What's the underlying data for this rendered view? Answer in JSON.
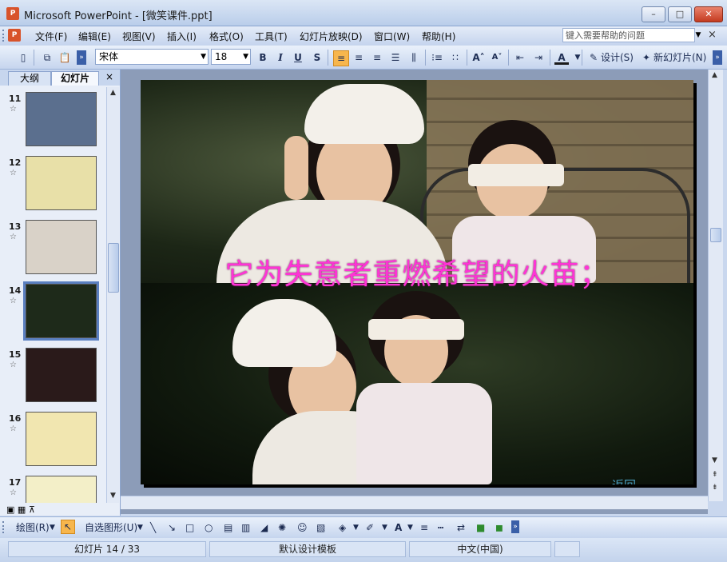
{
  "window": {
    "title": "Microsoft PowerPoint - [微笑课件.ppt]",
    "app_icon": "powerpoint-icon"
  },
  "menu": {
    "items": [
      "文件(F)",
      "编辑(E)",
      "视图(V)",
      "插入(I)",
      "格式(O)",
      "工具(T)",
      "幻灯片放映(D)",
      "窗口(W)",
      "帮助(H)"
    ],
    "help_placeholder": "键入需要帮助的问题",
    "close_glyph": "×"
  },
  "toolbar": {
    "font_name": "宋体",
    "font_size": "18",
    "bold": "B",
    "italic": "I",
    "underline": "U",
    "shadow": "S",
    "font_color_label": "A",
    "design_label": "设计(S)",
    "new_slide_label": "新幻灯片(N)"
  },
  "left_pane": {
    "tab_outline": "大纲",
    "tab_slides": "幻灯片",
    "close_glyph": "×",
    "slides": [
      {
        "number": "11",
        "bg": "#5b6f8e"
      },
      {
        "number": "12",
        "bg": "#e8e0a8"
      },
      {
        "number": "13",
        "bg": "#d9d2c8"
      },
      {
        "number": "14",
        "bg": "#1e2a1a",
        "selected": true
      },
      {
        "number": "15",
        "bg": "#2a1a1a"
      },
      {
        "number": "16",
        "bg": "#f1e6b0"
      },
      {
        "number": "17",
        "bg": "#f3efc8"
      }
    ]
  },
  "slide": {
    "caption": "它为失意者重燃希望的火苗；",
    "return_link": "返回"
  },
  "draw_toolbar": {
    "draw_label": "绘图(R)",
    "autoshapes_label": "自选图形(U)"
  },
  "status": {
    "slide_position": "幻灯片 14 / 33",
    "template": "默认设计模板",
    "language": "中文(中国)"
  },
  "colors": {
    "caption": "#ff33d6",
    "return_link": "#4aa0c2",
    "accent_highlight": "#f7b64d"
  }
}
